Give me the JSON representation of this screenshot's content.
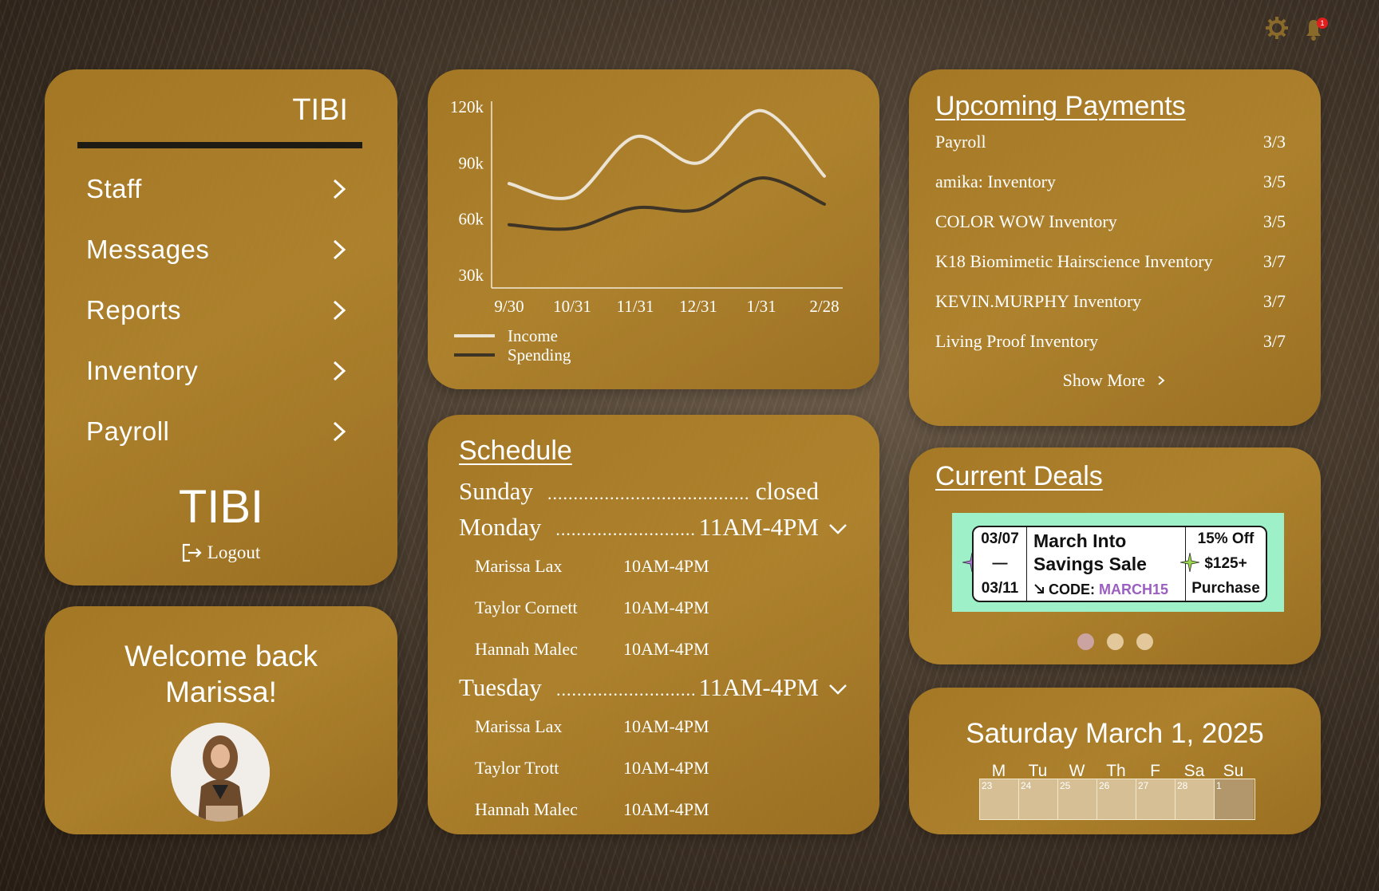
{
  "header": {
    "notification_count": "1"
  },
  "nav": {
    "brand_top": "TIBI",
    "items": [
      {
        "label": "Staff"
      },
      {
        "label": "Messages"
      },
      {
        "label": "Reports"
      },
      {
        "label": "Inventory"
      },
      {
        "label": "Payroll"
      }
    ],
    "brand_mid": "TIBI",
    "logout_label": "Logout"
  },
  "welcome": {
    "line1": "Welcome back",
    "line2": "Marissa!"
  },
  "chart_data": {
    "type": "line",
    "x": [
      "9/30",
      "10/31",
      "11/31",
      "12/31",
      "1/31",
      "2/28"
    ],
    "yticks": [
      "120k",
      "90k",
      "60k",
      "30k"
    ],
    "ylim": [
      30000,
      120000
    ],
    "series": [
      {
        "name": "Income",
        "color": "#ebe3d4",
        "values": [
          79000,
          72000,
          104000,
          90000,
          118000,
          83000
        ]
      },
      {
        "name": "Spending",
        "color": "#3d3426",
        "values": [
          57000,
          55000,
          66000,
          65000,
          82000,
          68000
        ]
      }
    ]
  },
  "schedule": {
    "title": "Schedule",
    "days": [
      {
        "day": "Sunday",
        "dots": "..............................................",
        "hours": "closed",
        "expand": false,
        "employees": []
      },
      {
        "day": "Monday",
        "dots": "..............................................",
        "hours": "11AM-4PM",
        "expand": true,
        "employees": [
          {
            "name": "Marissa Lax",
            "hours": "10AM-4PM"
          },
          {
            "name": "Taylor Cornett",
            "hours": "10AM-4PM"
          },
          {
            "name": "Hannah Malec",
            "hours": "10AM-4PM"
          }
        ]
      },
      {
        "day": "Tuesday",
        "dots": "..............................................",
        "hours": "11AM-4PM",
        "expand": true,
        "employees": [
          {
            "name": "Marissa Lax",
            "hours": "10AM-4PM"
          },
          {
            "name": "Taylor Trott",
            "hours": "10AM-4PM"
          },
          {
            "name": "Hannah Malec",
            "hours": "10AM-4PM"
          }
        ]
      }
    ]
  },
  "payments": {
    "title": "Upcoming Payments",
    "rows": [
      {
        "name": "Payroll",
        "date": "3/3"
      },
      {
        "name": "amika: Inventory",
        "date": "3/5"
      },
      {
        "name": "COLOR WOW Inventory",
        "date": "3/5"
      },
      {
        "name": "K18 Biomimetic Hairscience Inventory",
        "date": "3/7"
      },
      {
        "name": "KEVIN.MURPHY Inventory",
        "date": "3/7"
      },
      {
        "name": "Living Proof Inventory",
        "date": "3/7"
      }
    ],
    "show_more": "Show More"
  },
  "deals": {
    "title": "Current Deals",
    "coupon": {
      "start": "03/07",
      "dash": "—",
      "end": "03/11",
      "name_line1": "March Into",
      "name_line2": "Savings Sale",
      "code_label": "CODE:",
      "code": "MARCH15",
      "discount": "15% Off",
      "threshold": "$125+",
      "purchase": "Purchase"
    },
    "carousel_active": 1,
    "carousel_count": 3
  },
  "calendar": {
    "date_label": "Saturday March 1, 2025",
    "weekdays": [
      "M",
      "Tu",
      "W",
      "Th",
      "F",
      "Sa",
      "Su"
    ],
    "days": [
      "23",
      "24",
      "25",
      "26",
      "27",
      "28",
      "1"
    ]
  }
}
